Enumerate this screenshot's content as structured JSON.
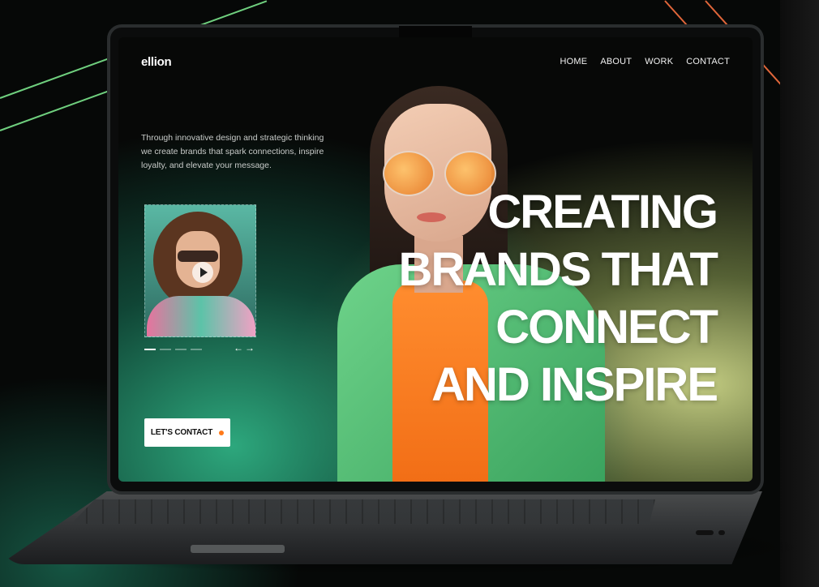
{
  "nav": {
    "logo": "ellion",
    "items": [
      "HOME",
      "ABOUT",
      "WORK",
      "CONTACT"
    ]
  },
  "hero": {
    "tagline": "Through innovative design and strategic thinking we create brands that spark connections, inspire loyalty, and elevate your message.",
    "headline_lines": [
      "CREATING",
      "BRANDS THAT",
      "CONNECT",
      "AND INSPIRE"
    ],
    "cta_label": "LET'S CONTACT"
  },
  "slider": {
    "dots_total": 4,
    "active_dot": 0,
    "prev_icon": "←",
    "next_icon": "→"
  },
  "colors": {
    "accent_green": "#2fb083",
    "accent_lime": "#d6e08e",
    "cta_dot": "#ff7a1a"
  }
}
